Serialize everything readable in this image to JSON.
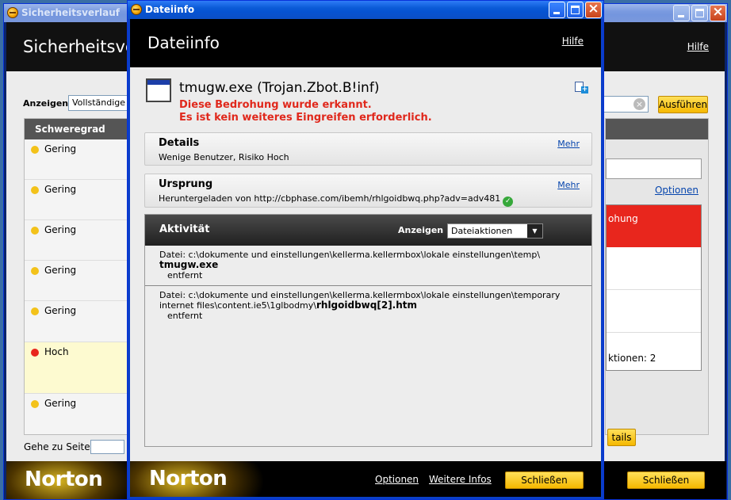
{
  "background_window": {
    "title": "Sicherheitsverlauf",
    "header_title": "Sicherheitsve",
    "help": "Hilfe",
    "filter_label": "Anzeigen",
    "filter_value": "Vollständige",
    "list_header": "Schweregrad",
    "rows": [
      {
        "label": "Gering"
      },
      {
        "label": "Gering"
      },
      {
        "label": "Gering"
      },
      {
        "label": "Gering"
      },
      {
        "label": "Gering"
      },
      {
        "label": "Hoch"
      },
      {
        "label": "Gering"
      }
    ],
    "goto_label": "Gehe zu Seite:",
    "run_button": "Ausführen",
    "options_link": "Optionen",
    "red_row_text": "ohung",
    "actions_count": "ktionen: 2",
    "details_button": "tails",
    "close_button": "Schließen",
    "brand": "Norton"
  },
  "dialog": {
    "window_title": "Dateiinfo",
    "header_title": "Dateiinfo",
    "help": "Hilfe",
    "file_name": "tmugw.exe (Trojan.Zbot.B!inf)",
    "warning_line1": "Diese Bedrohung wurde erkannt.",
    "warning_line2": "Es ist kein weiteres Eingreifen erforderlich.",
    "details": {
      "title": "Details",
      "text": "Wenige Benutzer,  Risiko Hoch",
      "more": "Mehr"
    },
    "origin": {
      "title": "Ursprung",
      "text": "Heruntergeladen von  http://cbphase.com/ibemh/rhlgoidbwq.php?adv=adv481",
      "more": "Mehr"
    },
    "activity": {
      "title": "Aktivität",
      "show_label": "Anzeigen",
      "show_value": "Dateiaktionen",
      "entries": [
        {
          "path": "Datei: c:\\dokumente und einstellungen\\kellerma.kellermbox\\lokale einstellungen\\temp\\",
          "path2": "",
          "file": "tmugw.exe",
          "status": "entfernt"
        },
        {
          "path": "Datei: c:\\dokumente und einstellungen\\kellerma.kellermbox\\lokale einstellungen\\temporary",
          "path2": "internet files\\content.ie5\\1glbodmy\\",
          "file": "rhlgoidbwq[2].htm",
          "status": "entfernt"
        }
      ]
    },
    "footer": {
      "brand": "Norton",
      "options": "Optionen",
      "more_info": "Weitere Infos",
      "close": "Schließen"
    }
  }
}
